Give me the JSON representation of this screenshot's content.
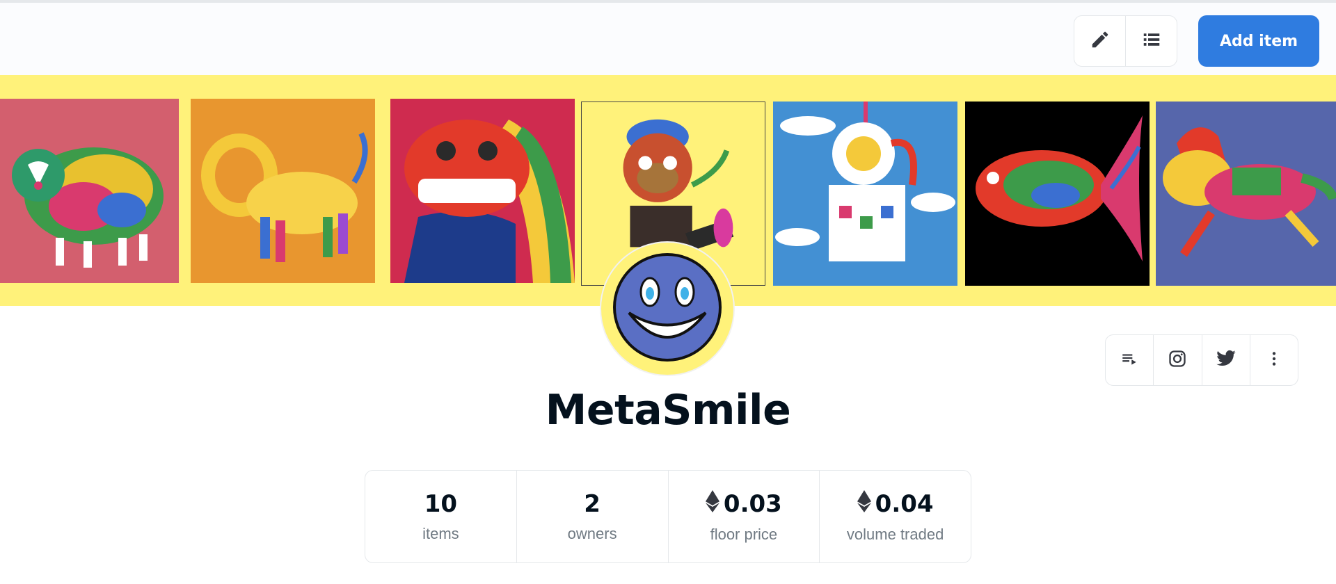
{
  "toolbar": {
    "icons": [
      "pencil-icon",
      "list-icon"
    ],
    "add_label": "Add item",
    "accent": "#2f7ce0"
  },
  "banner": {
    "background": "#fff27a",
    "tiles": [
      {
        "subject": "sheep",
        "background": "#d35f6e"
      },
      {
        "subject": "lion",
        "background": "#e8962f"
      },
      {
        "subject": "lion-dance",
        "background": "#cf2b4f"
      },
      {
        "subject": "monkey",
        "background": "#fff27a"
      },
      {
        "subject": "poodle",
        "background": "#4390d3"
      },
      {
        "subject": "fish",
        "background": "#000000"
      },
      {
        "subject": "horse",
        "background": "#5666ab"
      }
    ]
  },
  "collection": {
    "name": "MetaSmile",
    "avatar": "smiley-face"
  },
  "social_icons": [
    "activity-icon",
    "instagram-icon",
    "twitter-icon",
    "more-icon"
  ],
  "stats": [
    {
      "value": "10",
      "label": "items",
      "eth": false
    },
    {
      "value": "2",
      "label": "owners",
      "eth": false
    },
    {
      "value": "0.03",
      "label": "floor price",
      "eth": true
    },
    {
      "value": "0.04",
      "label": "volume traded",
      "eth": true
    }
  ]
}
